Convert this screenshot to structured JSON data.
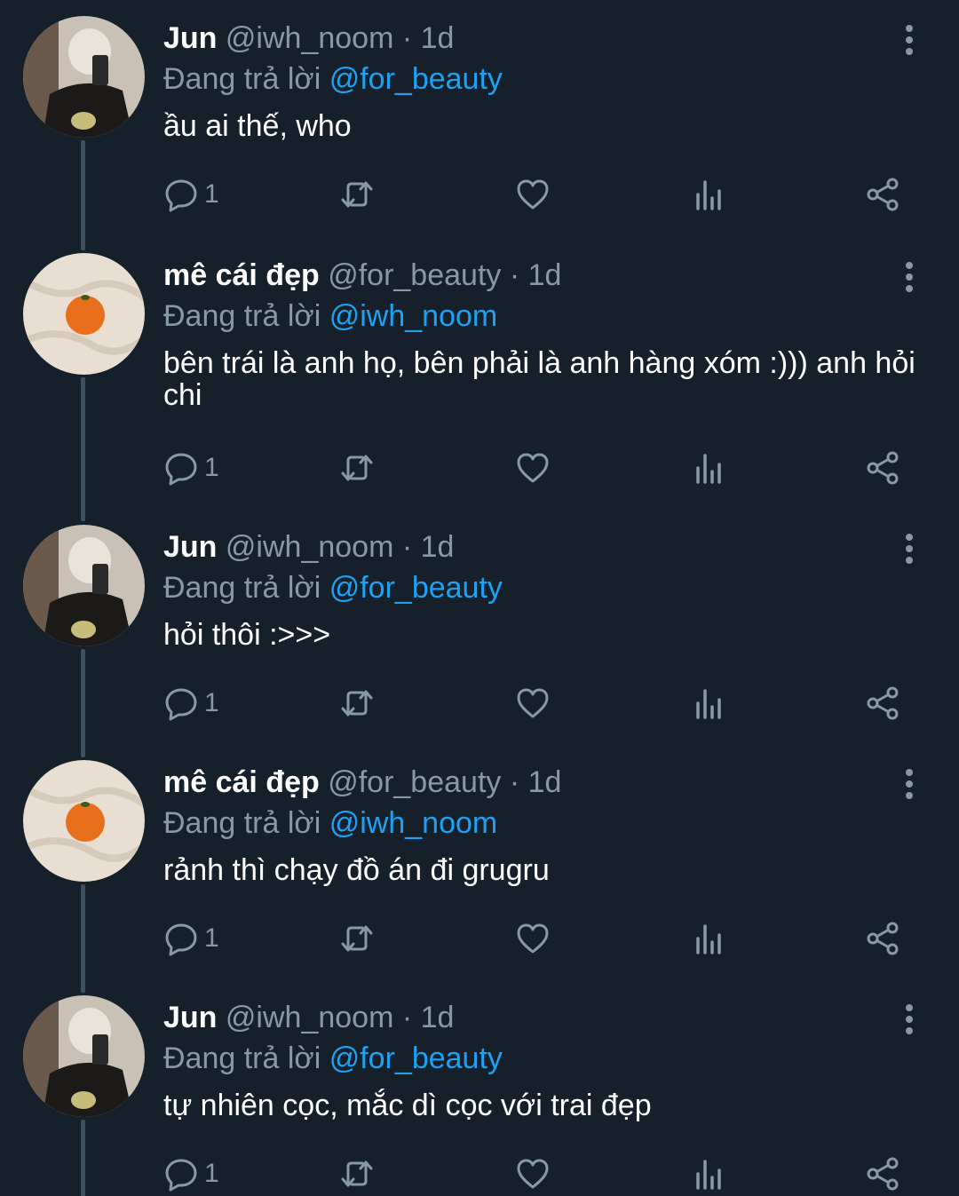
{
  "icons": {
    "reply": "reply-icon",
    "retweet": "retweet-icon",
    "like": "heart-icon",
    "analytics": "analytics-icon",
    "share": "share-icon",
    "more": "more-vertical-icon"
  },
  "colors": {
    "background": "#15202b",
    "secondary_text": "#8899a6",
    "mention": "#1da1f2",
    "thread_line": "#3d4f60"
  },
  "tweets": [
    {
      "name": "Jun",
      "handle": "@iwh_noom",
      "time": "· 1d",
      "reply_prefix": "Đang trả lời",
      "reply_to": "@for_beauty",
      "text": "ầu ai thế, who",
      "reply_count": "1"
    },
    {
      "name": "mê cái đẹp",
      "handle": "@for_beauty",
      "time": "· 1d",
      "reply_prefix": "Đang trả lời",
      "reply_to": "@iwh_noom",
      "text": "bên trái là anh họ, bên phải là anh hàng xóm :))) anh hỏi chi",
      "reply_count": "1"
    },
    {
      "name": "Jun",
      "handle": "@iwh_noom",
      "time": "· 1d",
      "reply_prefix": "Đang trả lời",
      "reply_to": "@for_beauty",
      "text": "hỏi thôi :>>>",
      "reply_count": "1"
    },
    {
      "name": "mê cái đẹp",
      "handle": "@for_beauty",
      "time": "· 1d",
      "reply_prefix": "Đang trả lời",
      "reply_to": "@iwh_noom",
      "text": "rảnh thì chạy đồ án đi grugru",
      "reply_count": "1"
    },
    {
      "name": "Jun",
      "handle": "@iwh_noom",
      "time": "· 1d",
      "reply_prefix": "Đang trả lời",
      "reply_to": "@for_beauty",
      "text": "tự nhiên cọc, mắc dì cọc với trai đẹp",
      "reply_count": "1"
    }
  ]
}
